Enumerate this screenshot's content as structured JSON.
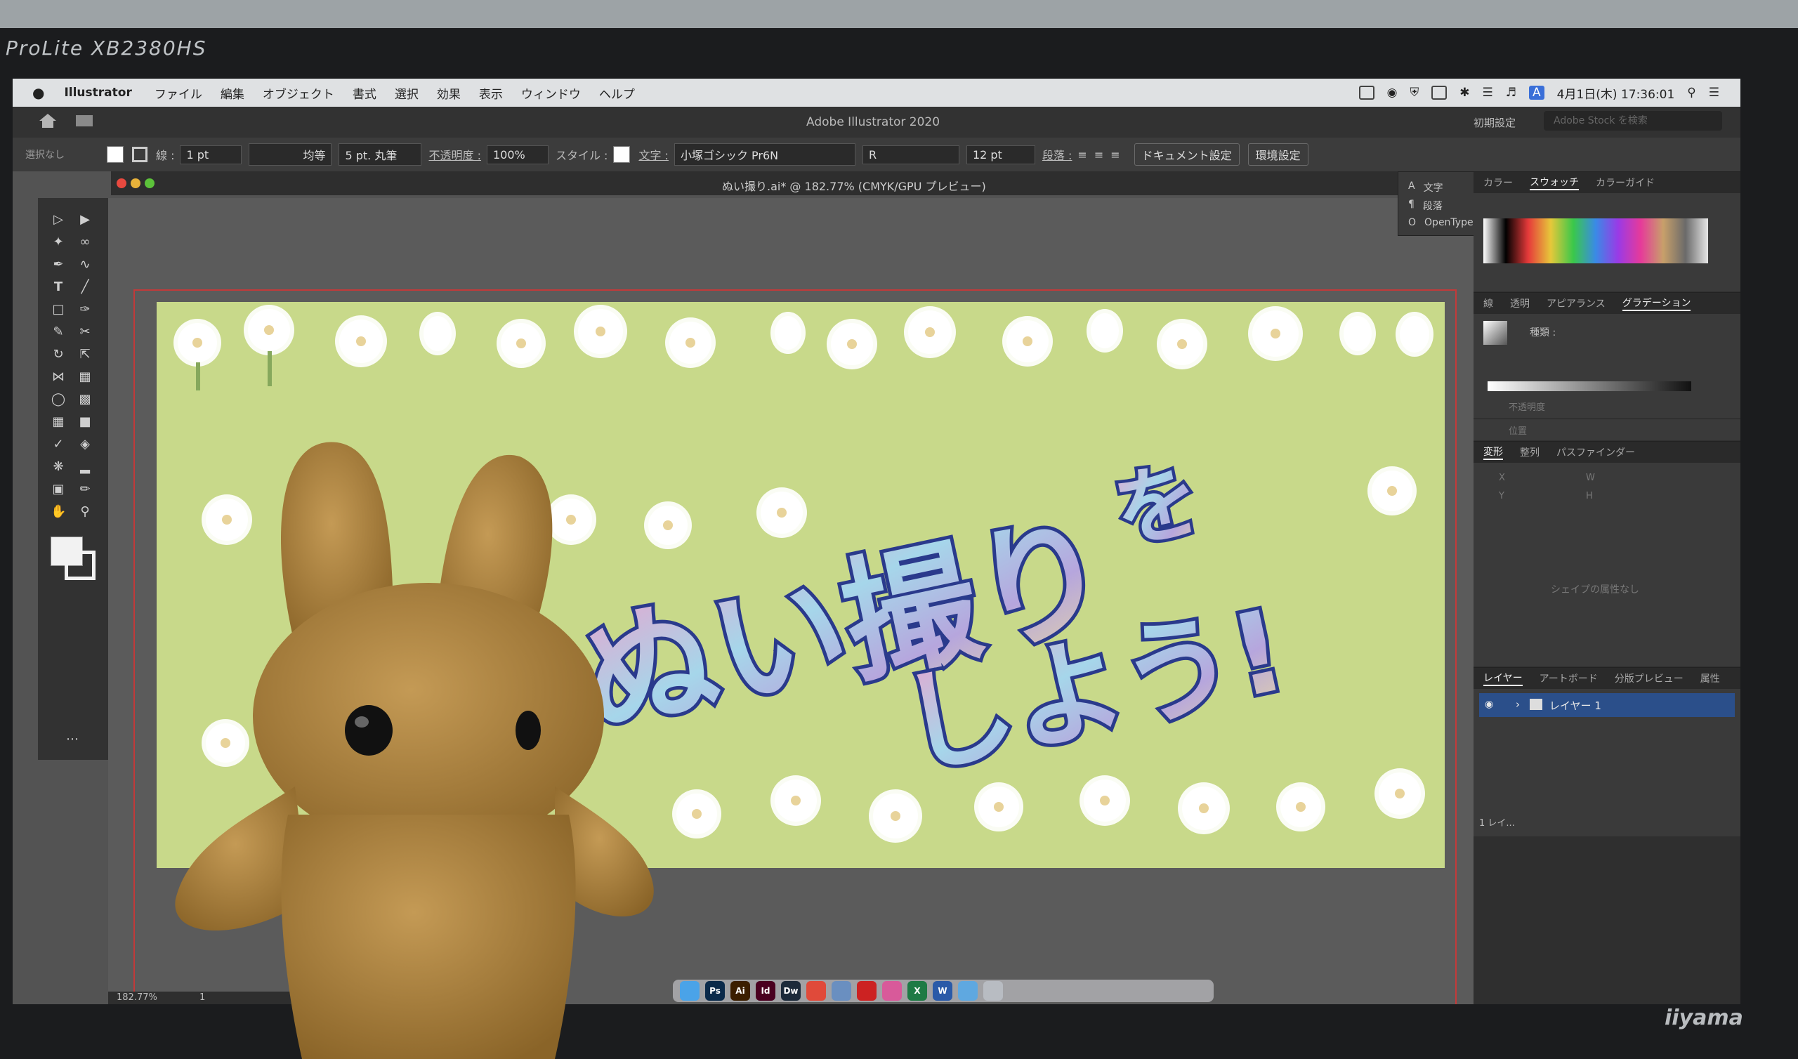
{
  "monitor": {
    "brand_top": "ProLite XB2380HS",
    "brand_bottom": "iiyama"
  },
  "menubar": {
    "apple_icon": "apple-icon",
    "app_name": "Illustrator",
    "items": [
      "ファイル",
      "編集",
      "オブジェクト",
      "書式",
      "選択",
      "効果",
      "表示",
      "ウィンドウ",
      "ヘルプ"
    ],
    "clock": "4月1日(木) 17:36:01",
    "input_badge": "A"
  },
  "titlebar": {
    "title": "Adobe Illustrator 2020",
    "workspace_preset": "初期設定",
    "stock_search_placeholder": "Adobe Stock を検索"
  },
  "controlbar": {
    "selection_label": "選択なし",
    "stroke_label": "線 :",
    "stroke_weight": "1 pt",
    "stroke_profile": "均等",
    "brush": "5 pt. 丸筆",
    "opacity_label": "不透明度 :",
    "opacity_value": "100%",
    "style_label": "スタイル :",
    "char_label": "文字 :",
    "font_family": "小塚ゴシック Pr6N",
    "font_style": "R",
    "font_size": "12 pt",
    "paragraph_label": "段落 :",
    "doc_settings_btn": "ドキュメント設定",
    "prefs_btn": "環境設定"
  },
  "document_tab": {
    "label": "ぬい撮り.ai* @ 182.77% (CMYK/GPU プレビュー)"
  },
  "mini_panel": {
    "items": [
      "文字",
      "段落",
      "OpenType"
    ]
  },
  "panels": {
    "color_tabs": [
      "カラー",
      "スウォッチ",
      "カラーガイド"
    ],
    "color_active": "スウォッチ",
    "appearance_tabs": [
      "線",
      "透明",
      "アピアランス",
      "グラデーション"
    ],
    "appearance_active": "グラデーション",
    "gradient_type_label": "種類 :",
    "opacity_label": "不透明度",
    "position_label": "位置",
    "transform_tabs": [
      "変形",
      "整列",
      "パスファインダー"
    ],
    "transform_active": "変形",
    "transform_fields": [
      "X",
      "W",
      "Y",
      "H"
    ],
    "no_shape_text": "シェイプの属性なし",
    "layer_tabs": [
      "レイヤー",
      "アートボード",
      "分版プレビュー",
      "属性"
    ],
    "layer_active": "レイヤー",
    "layer_name": "レイヤー 1",
    "layer_count": "1 レイ..."
  },
  "artwork": {
    "headline_line1": "ぬい撮り",
    "headline_line2": "を",
    "headline_line3": "しよう!",
    "background_color": "#c8d98a",
    "outline_color": "#2a3a8c"
  },
  "statusbar": {
    "zoom": "182.77%",
    "artboard_no": "1"
  },
  "dock": {
    "apps": [
      {
        "name": "finder-icon",
        "label": "",
        "color": "#4aa3e8"
      },
      {
        "name": "photoshop-icon",
        "label": "Ps",
        "color": "#0b2a4a"
      },
      {
        "name": "illustrator-icon",
        "label": "Ai",
        "color": "#3b1e00"
      },
      {
        "name": "indesign-icon",
        "label": "Id",
        "color": "#4a0020"
      },
      {
        "name": "dreamweaver-icon",
        "label": "Dw",
        "color": "#1c2a3a"
      },
      {
        "name": "chrome-icon",
        "label": "",
        "color": "#e04a3a"
      },
      {
        "name": "preview-icon",
        "label": "",
        "color": "#6a8fc0"
      },
      {
        "name": "acrobat-icon",
        "label": "",
        "color": "#cc2222"
      },
      {
        "name": "photos-icon",
        "label": "",
        "color": "#d85a9a"
      },
      {
        "name": "excel-icon",
        "label": "X",
        "color": "#1e7a45"
      },
      {
        "name": "word-icon",
        "label": "W",
        "color": "#2a5aa8"
      },
      {
        "name": "folder-icon",
        "label": "",
        "color": "#5fa8e0"
      },
      {
        "name": "trash-icon",
        "label": "",
        "color": "#b8bcc2"
      }
    ]
  }
}
